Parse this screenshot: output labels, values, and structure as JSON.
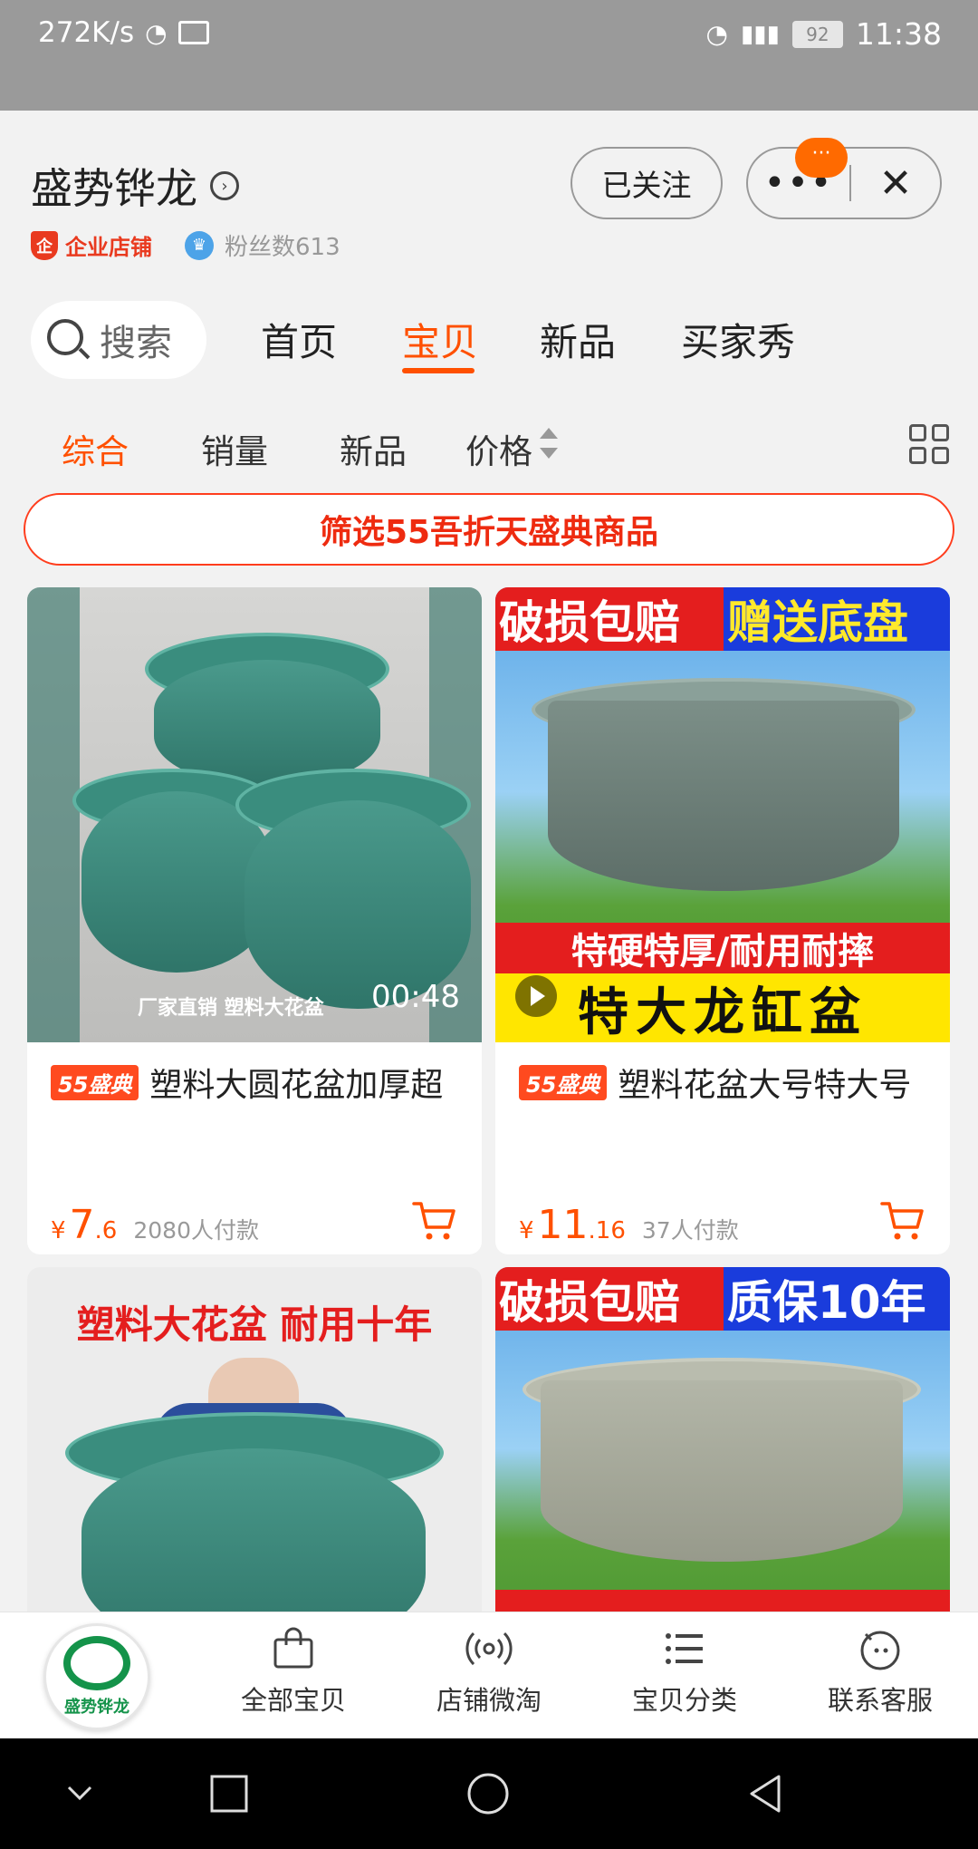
{
  "status_bar": {
    "speed": "272K/s",
    "battery": "92",
    "time": "11:38"
  },
  "shop": {
    "name": "盛势铧龙",
    "badge": "企业店铺",
    "fans": "粉丝数613",
    "follow_label": "已关注",
    "more_badge": "···"
  },
  "nav": {
    "search_label": "搜索",
    "tabs": [
      "首页",
      "宝贝",
      "新品",
      "买家秀"
    ],
    "active_tab": "宝贝"
  },
  "sort": {
    "items": [
      "综合",
      "销量",
      "新品",
      "价格"
    ],
    "active": "综合"
  },
  "promo": "筛选55吾折天盛典商品",
  "products": [
    {
      "tag": "55盛典",
      "title": "塑料大圆花盆加厚超",
      "currency": "¥",
      "price_int": "7",
      "price_dec": ".6",
      "sold": "2080人付款",
      "overlay_text": "厂家直销 塑料大花盆",
      "video_time": "00:48"
    },
    {
      "tag": "55盛典",
      "title": "塑料花盆大号特大号",
      "currency": "¥",
      "price_int": "11",
      "price_dec": ".16",
      "sold": "37人付款",
      "banner_red": "破损包赔",
      "banner_blue": "赠送底盘",
      "strip_red": "特硬特厚/耐用耐摔",
      "strip_yellow": "特大龙缸盆"
    },
    {
      "banner_text": "塑料大花盆 耐用十年"
    },
    {
      "banner_red": "破损包赔",
      "banner_blue": "质保10年"
    }
  ],
  "tabbar": {
    "logo_text": "盛势铧龙",
    "items": [
      "全部宝贝",
      "店铺微淘",
      "宝贝分类",
      "联系客服"
    ]
  },
  "colors": {
    "accent": "#ff5000",
    "promo_red": "#ee2b10",
    "brand_green": "#14934a"
  }
}
